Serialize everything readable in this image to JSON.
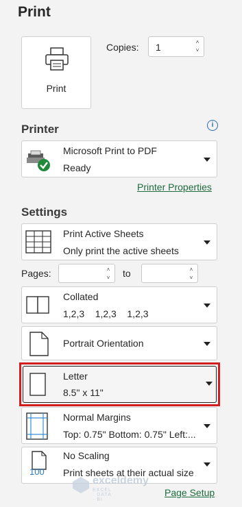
{
  "title": "Print",
  "print_button": {
    "label": "Print"
  },
  "copies": {
    "label": "Copies:",
    "value": "1"
  },
  "printer": {
    "section_label": "Printer",
    "name": "Microsoft Print to PDF",
    "status": "Ready",
    "properties_link": "Printer Properties"
  },
  "settings": {
    "section_label": "Settings",
    "print_what": {
      "title": "Print Active Sheets",
      "subtitle": "Only print the active sheets"
    },
    "pages": {
      "label": "Pages:",
      "to_label": "to",
      "from_value": "",
      "to_value": ""
    },
    "collation": {
      "title": "Collated",
      "subtitle": "1,2,3    1,2,3    1,2,3"
    },
    "orientation": {
      "title": "Portrait Orientation"
    },
    "paper": {
      "title": "Letter",
      "subtitle": "8.5\" x 11\""
    },
    "margins": {
      "title": "Normal Margins",
      "subtitle": "Top: 0.75\" Bottom: 0.75\" Left:..."
    },
    "scaling": {
      "title": "No Scaling",
      "subtitle": "Print sheets at their actual size",
      "icon_text": "100"
    },
    "page_setup_link": "Page Setup"
  },
  "watermark": {
    "name": "exceldemy",
    "tagline": "EXCEL · DATA · BI"
  },
  "colors": {
    "link": "#1c6b3c",
    "highlight": "#d11e1e",
    "info": "#2a6ab3",
    "printer_ok": "#1e8a3a"
  }
}
